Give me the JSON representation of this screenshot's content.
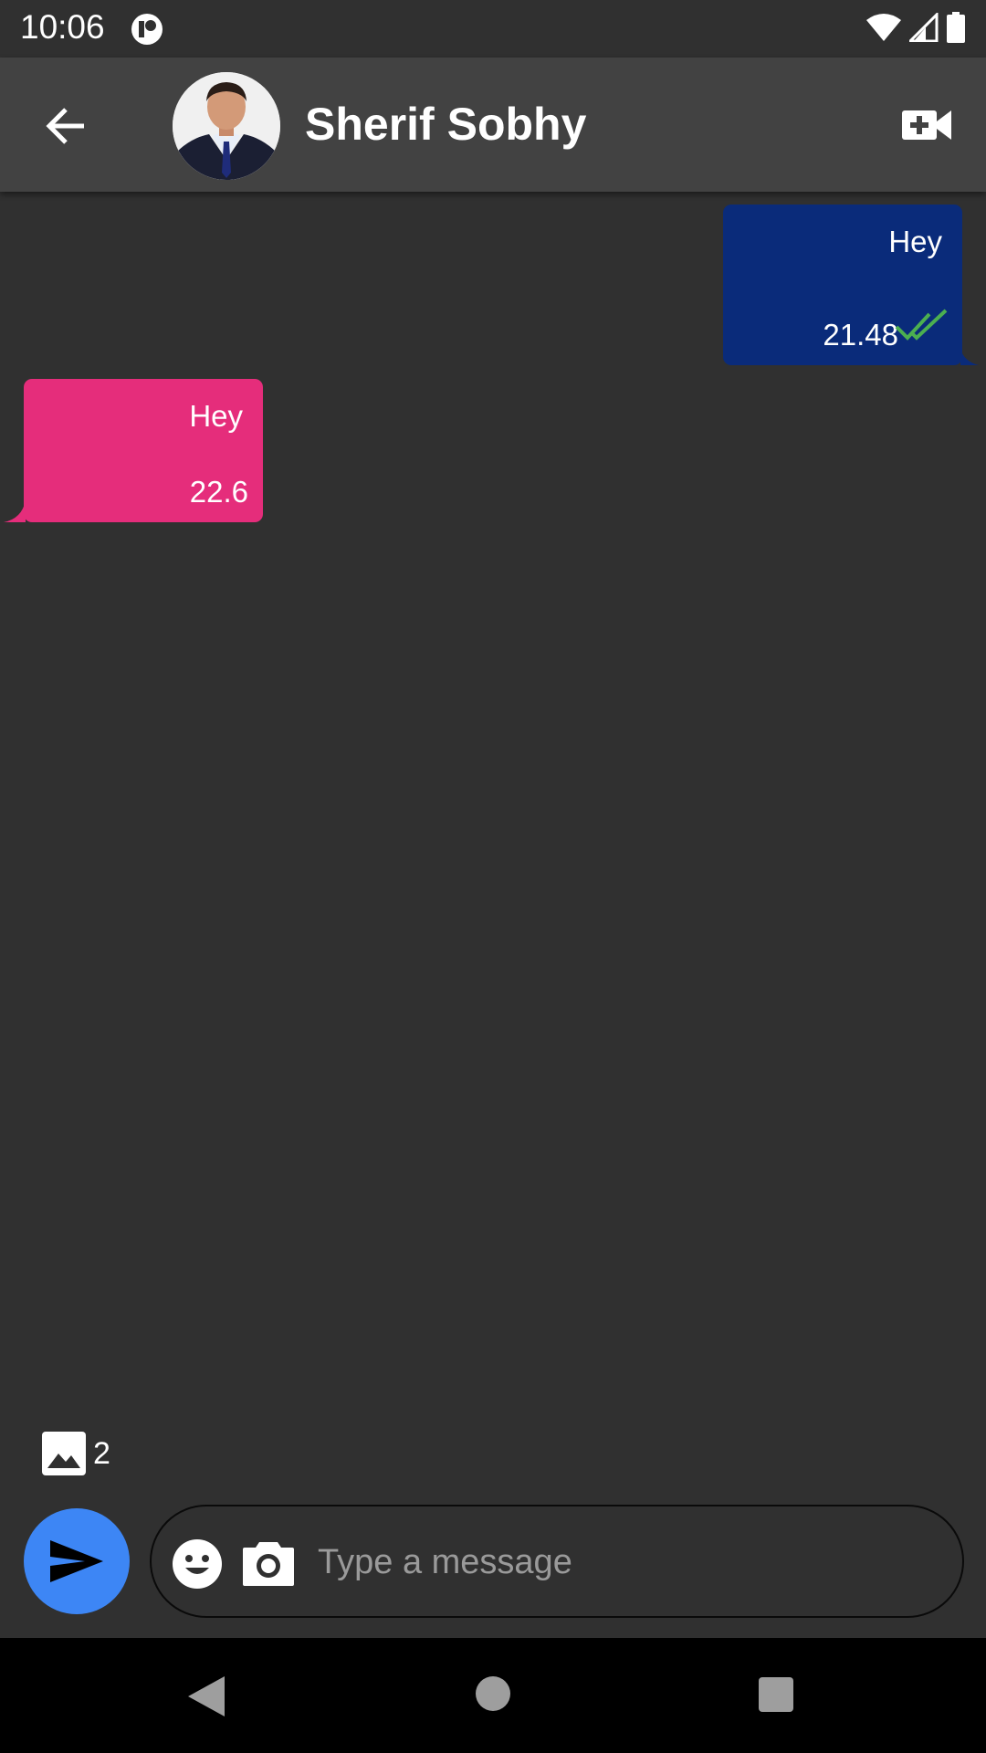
{
  "status_bar": {
    "time": "10:06",
    "app_icon": "app-notification-icon",
    "icons": [
      "wifi-icon",
      "signal-icon",
      "battery-icon"
    ]
  },
  "header": {
    "back_icon": "arrow-back-icon",
    "contact_name": "Sherif Sobhy",
    "video_call_icon": "video-call-icon"
  },
  "messages": [
    {
      "direction": "outgoing",
      "text": "Hey",
      "time": "21.48",
      "status_icon": "double-check-icon",
      "bubble_color": "#0a2b7a"
    },
    {
      "direction": "incoming",
      "text": "Hey",
      "time": "22.6",
      "bubble_color": "#e52d7b"
    }
  ],
  "media_indicator": {
    "icon": "image-icon",
    "count": "2"
  },
  "composer": {
    "placeholder": "Type a message",
    "emoji_icon": "emoji-icon",
    "camera_icon": "camera-icon",
    "send_icon": "send-icon",
    "send_button_color": "#3d86f5"
  },
  "nav_bar": {
    "icons": [
      "nav-back-icon",
      "nav-home-icon",
      "nav-recents-icon"
    ]
  },
  "colors": {
    "background": "#303030",
    "app_bar": "#424242",
    "read_tick": "#4caf50"
  }
}
